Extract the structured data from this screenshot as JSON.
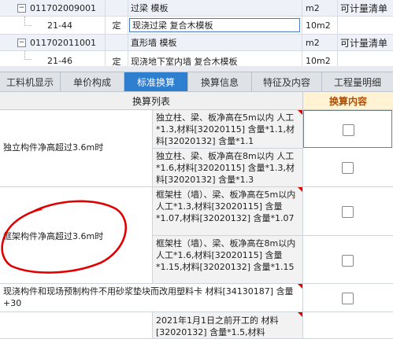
{
  "top_rows": [
    {
      "code": "011702009001",
      "type": "",
      "name": "过梁 模板",
      "unit": "m2",
      "rule": "可计量清单",
      "kind": "group"
    },
    {
      "code": "21-44",
      "type": "定",
      "name": "现浇过梁 复合木模板",
      "unit": "10m2",
      "rule": "",
      "kind": "sel"
    },
    {
      "code": "011702011001",
      "type": "",
      "name": "直形墙 模板",
      "unit": "m2",
      "rule": "可计量清单",
      "kind": "group"
    },
    {
      "code": "21-46",
      "type": "定",
      "name": "现浇地下室内墙 复合木模板",
      "unit": "10m2",
      "rule": "",
      "kind": "item"
    }
  ],
  "tabs": [
    {
      "label": "工料机显示",
      "active": false
    },
    {
      "label": "单价构成",
      "active": false
    },
    {
      "label": "标准换算",
      "active": true
    },
    {
      "label": "换算信息",
      "active": false
    },
    {
      "label": "特征及内容",
      "active": false
    },
    {
      "label": "工程量明细",
      "active": false
    }
  ],
  "panel": {
    "col_list": "换算列表",
    "col_content": "换算内容",
    "groups": [
      {
        "label": "独立构件净高超过3.6m时",
        "items": [
          "独立柱、梁、板净高在5m以内 人工*1.3,材料[32020115] 含量*1.1,材料[32020132] 含量*1.1",
          "独立柱、梁、板净高在8m以内 人工*1.6,材料[32020115] 含量*1.3,材料[32020132] 含量*1.3"
        ]
      },
      {
        "label": "框架构件净高超过3.6m时",
        "items": [
          "框架柱（墙）、梁、板净高在5m以内 人工*1.3,材料[32020115] 含量*1.07,材料[32020132] 含量*1.07",
          "框架柱（墙）、梁、板净高在8m以内 人工*1.6,材料[32020115] 含量*1.15,材料[32020132] 含量*1.15"
        ]
      }
    ],
    "single_row": "现浇构件和现场预制构件不用砂浆垫块而改用塑料卡 材料[34130187] 含量+30",
    "last_item": "2021年1月1日之前开工的 材料[32020132] 含量*1.5,材料"
  },
  "colors": {
    "accent": "#2f7fd1",
    "annotation": "#e00000"
  }
}
